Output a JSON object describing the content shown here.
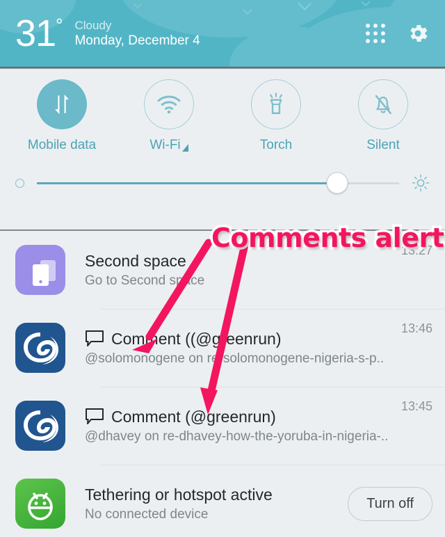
{
  "header": {
    "temperature": "31",
    "degree_symbol": "°",
    "condition": "Cloudy",
    "date": "Monday, December 4",
    "grid_icon": "grid-dots-icon",
    "settings_icon": "gear-icon"
  },
  "quick_settings": {
    "toggles": [
      {
        "label": "Mobile data",
        "icon": "mobile-data-icon",
        "state": "on"
      },
      {
        "label": "Wi-Fi",
        "icon": "wifi-icon",
        "state": "off",
        "has_arrow": true
      },
      {
        "label": "Torch",
        "icon": "torch-icon",
        "state": "off"
      },
      {
        "label": "Silent",
        "icon": "bell-off-icon",
        "state": "off"
      }
    ],
    "brightness": {
      "min_icon": "brightness-low-icon",
      "max_icon": "brightness-high-icon",
      "value": 83
    }
  },
  "annotation": {
    "text": "Comments alert",
    "color": "#f4155f"
  },
  "notifications": [
    {
      "app_icon": "second-space-icon",
      "title": "Second space",
      "subtitle": "Go to Second space",
      "time": "13:27",
      "has_bubble": false,
      "action": null
    },
    {
      "app_icon": "esteem-app-icon",
      "title": "Comment ((@greenrun)",
      "subtitle": "@solomonogene on re-solomonogene-nigeria-s-p..",
      "time": "13:46",
      "has_bubble": true,
      "bubble_icon": "comment-bubble-icon",
      "action": null
    },
    {
      "app_icon": "esteem-app-icon",
      "title": "Comment (@greenrun)",
      "subtitle": "@dhavey on re-dhavey-how-the-yoruba-in-nigeria-..",
      "time": "13:45",
      "has_bubble": true,
      "bubble_icon": "comment-bubble-icon",
      "action": null
    },
    {
      "app_icon": "android-hotspot-icon",
      "title": "Tethering or hotspot active",
      "subtitle": "No connected device",
      "time": "",
      "has_bubble": false,
      "action": "Turn off"
    }
  ],
  "colors": {
    "header_teal": "#52b5c6",
    "panel_bg": "#eceff1",
    "accent_teal": "#4ba3b6",
    "annotation_pink": "#f4155f"
  }
}
